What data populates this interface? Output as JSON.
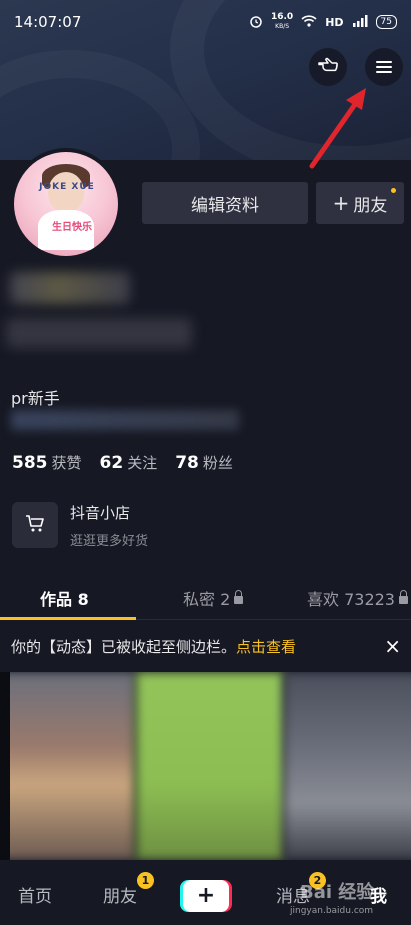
{
  "status_bar": {
    "time": "14:07:07",
    "speed_value": "16.0",
    "speed_unit": "KB/S",
    "network": "HD",
    "battery": "75"
  },
  "profile": {
    "edit_label": "编辑资料",
    "friend_label": "朋友",
    "bio": "pr新手",
    "stats": [
      {
        "num": "585",
        "label": "获赞"
      },
      {
        "num": "62",
        "label": "关注"
      },
      {
        "num": "78",
        "label": "粉丝"
      }
    ]
  },
  "shop": {
    "title": "抖音小店",
    "subtitle": "逛逛更多好货"
  },
  "tabs": [
    {
      "label": "作品 8"
    },
    {
      "label": "私密 2"
    },
    {
      "label": "喜欢 73223"
    }
  ],
  "notice": {
    "text": "你的【动态】已被收起至侧边栏。",
    "link": "点击查看",
    "close": "×"
  },
  "bottom_nav": {
    "home": "首页",
    "friends": "朋友",
    "friends_badge": "1",
    "messages": "消息",
    "messages_badge": "2",
    "me": "我"
  },
  "watermark": {
    "brand": "Bai 经验",
    "url": "jingyan.baidu.com"
  },
  "avatar": {
    "text_top": "JOKE XUE",
    "text_bottom": "生日快乐"
  },
  "colors": {
    "background": "#161823",
    "accent": "#f9c224",
    "arrow": "#e0262c"
  }
}
